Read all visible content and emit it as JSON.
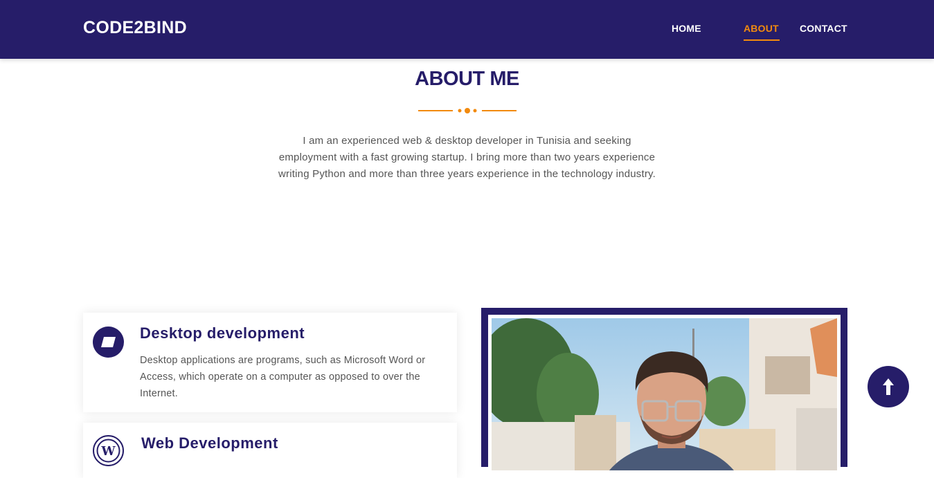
{
  "colors": {
    "primary": "#261d69",
    "accent": "#f28a0e",
    "text_muted": "#555555"
  },
  "navbar": {
    "brand": "CODE2BIND",
    "links": [
      {
        "label": "HOME",
        "active": false
      },
      {
        "label": "ABOUT",
        "active": true
      },
      {
        "label": "CONTACT",
        "active": false
      }
    ]
  },
  "about": {
    "title": "ABOUT ME",
    "description": "I am an experienced web & desktop developer in Tunisia and seeking employment with a fast growing startup. I bring more than two years experience writing Python and more than three years experience in the technology industry."
  },
  "services": [
    {
      "icon": "desktop-parallelogram-icon",
      "title": "Desktop development",
      "description": "Desktop applications are programs, such as Microsoft Word or Access, which operate on a computer as opposed to over the Internet."
    },
    {
      "icon": "wordpress-icon",
      "title": "Web Development",
      "description": ""
    }
  ],
  "scroll_top": {
    "icon": "arrow-up-icon"
  }
}
